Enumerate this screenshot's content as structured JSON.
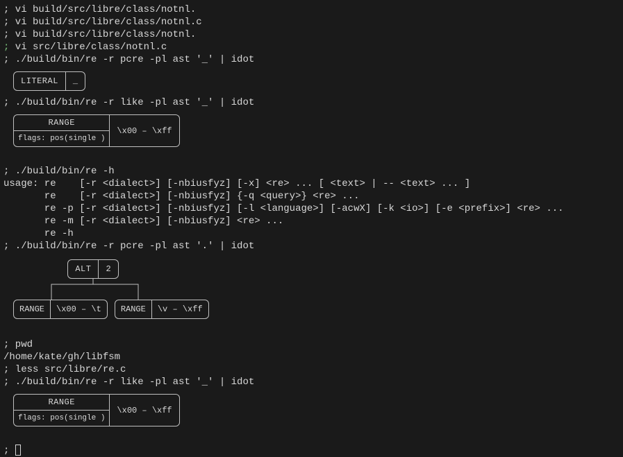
{
  "prompt": ";",
  "cmd1": " vi build/src/libre/class/notnl.",
  "cmd2": " vi build/src/libre/class/notnl.c",
  "cmd3": " vi build/src/libre/class/notnl.",
  "cmd4": " vi src/libre/class/notnl.c",
  "cmd5": " ./build/bin/re -r pcre -pl ast '_' | idot",
  "literal_box": {
    "label": "LITERAL",
    "value": "_"
  },
  "cmd6": " ./build/bin/re -r like -pl ast '_' | idot",
  "range_box1": {
    "label": "RANGE",
    "flags": "flags: pos(single )",
    "range": "\\x00 – \\xff"
  },
  "cmd7": " ./build/bin/re -h",
  "usage": [
    "usage: re    [-r <dialect>] [-nbiusfyz] [-x] <re> ... [ <text> | -- <text> ... ]",
    "       re    [-r <dialect>] [-nbiusfyz] {-q <query>} <re> ...",
    "       re -p [-r <dialect>] [-nbiusfyz] [-l <language>] [-acwX] [-k <io>] [-e <prefix>] <re> ...",
    "       re -m [-r <dialect>] [-nbiusfyz] <re> ...",
    "       re -h"
  ],
  "cmd8": " ./build/bin/re -r pcre -pl ast '.' | idot",
  "alt_box": {
    "label": "ALT",
    "count": "2"
  },
  "range_a": {
    "label": "RANGE",
    "range": "\\x00 – \\t"
  },
  "range_b": {
    "label": "RANGE",
    "range": "\\v – \\xff"
  },
  "cmd9": " pwd",
  "pwd_out": "/home/kate/gh/libfsm",
  "cmd10": " less src/libre/re.c",
  "cmd11": " ./build/bin/re -r like -pl ast '_' | idot",
  "range_box2": {
    "label": "RANGE",
    "flags": "flags: pos(single )",
    "range": "\\x00 – \\xff"
  }
}
